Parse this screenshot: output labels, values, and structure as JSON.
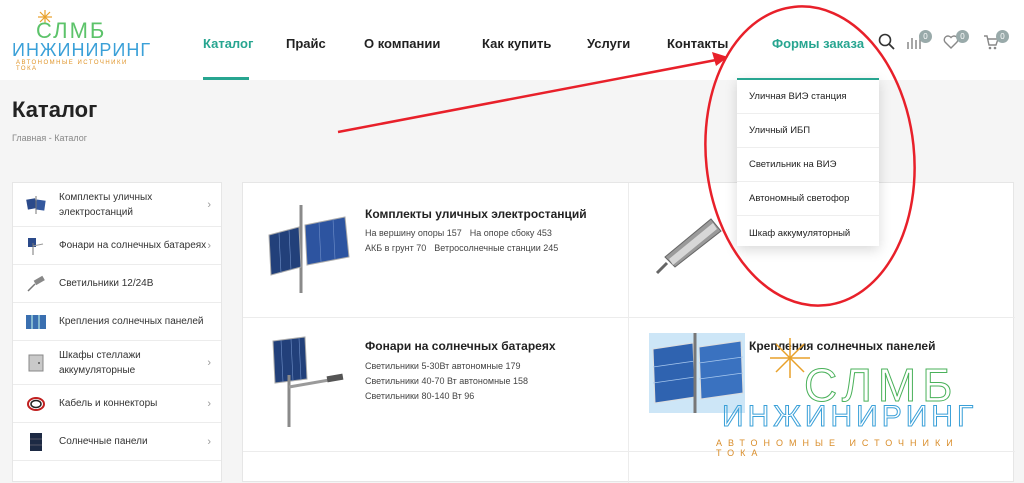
{
  "logo": {
    "line1": "СЛМБ",
    "line2": "ИНЖИНИРИНГ",
    "line3": "АВТОНОМНЫЕ ИСТОЧНИКИ ТОКА"
  },
  "nav": {
    "items": [
      {
        "label": "Каталог"
      },
      {
        "label": "Прайс"
      },
      {
        "label": "О компании"
      },
      {
        "label": "Как купить"
      },
      {
        "label": "Услуги"
      },
      {
        "label": "Контакты"
      },
      {
        "label": "Формы заказа"
      }
    ],
    "active": "Каталог"
  },
  "tools": {
    "compare_count": "0",
    "favorites_count": "0",
    "cart_count": "0"
  },
  "page": {
    "title": "Каталог",
    "breadcrumb": {
      "home": "Главная",
      "sep": " - ",
      "current": "Каталог"
    }
  },
  "sidebar": {
    "items": [
      {
        "label": "Комплекты уличных электростанций"
      },
      {
        "label": "Фонари на солнечных батареях"
      },
      {
        "label": "Светильники 12/24В"
      },
      {
        "label": "Крепления солнечных панелей"
      },
      {
        "label": "Шкафы стеллажи аккумуляторные"
      },
      {
        "label": "Кабель и коннекторы"
      },
      {
        "label": "Солнечные панели"
      }
    ]
  },
  "grid": {
    "cells": [
      {
        "title": "Комплекты уличных электростанций",
        "links": [
          "На вершину опоры 157",
          "На опоре сбоку 453",
          "АКБ в грунт 70",
          "Ветросолнечные станции 245"
        ]
      },
      {
        "title": ""
      },
      {
        "title": "Фонари на солнечных батареях",
        "links": [
          "Светильники 5-30Вт автономные 179",
          "Светильники 40-70 Вт автономные 158",
          "Светильники 80-140 Вт 96"
        ]
      },
      {
        "title": "Крепления солнечных панелей"
      }
    ]
  },
  "dropdown": {
    "items": [
      {
        "label": "Уличная ВИЭ станция"
      },
      {
        "label": "Уличный ИБП"
      },
      {
        "label": "Светильник на ВИЭ"
      },
      {
        "label": "Автономный светофор"
      },
      {
        "label": "Шкаф аккумуляторный"
      }
    ]
  },
  "colors": {
    "accent": "#27a590",
    "annotation": "#e8202a"
  }
}
